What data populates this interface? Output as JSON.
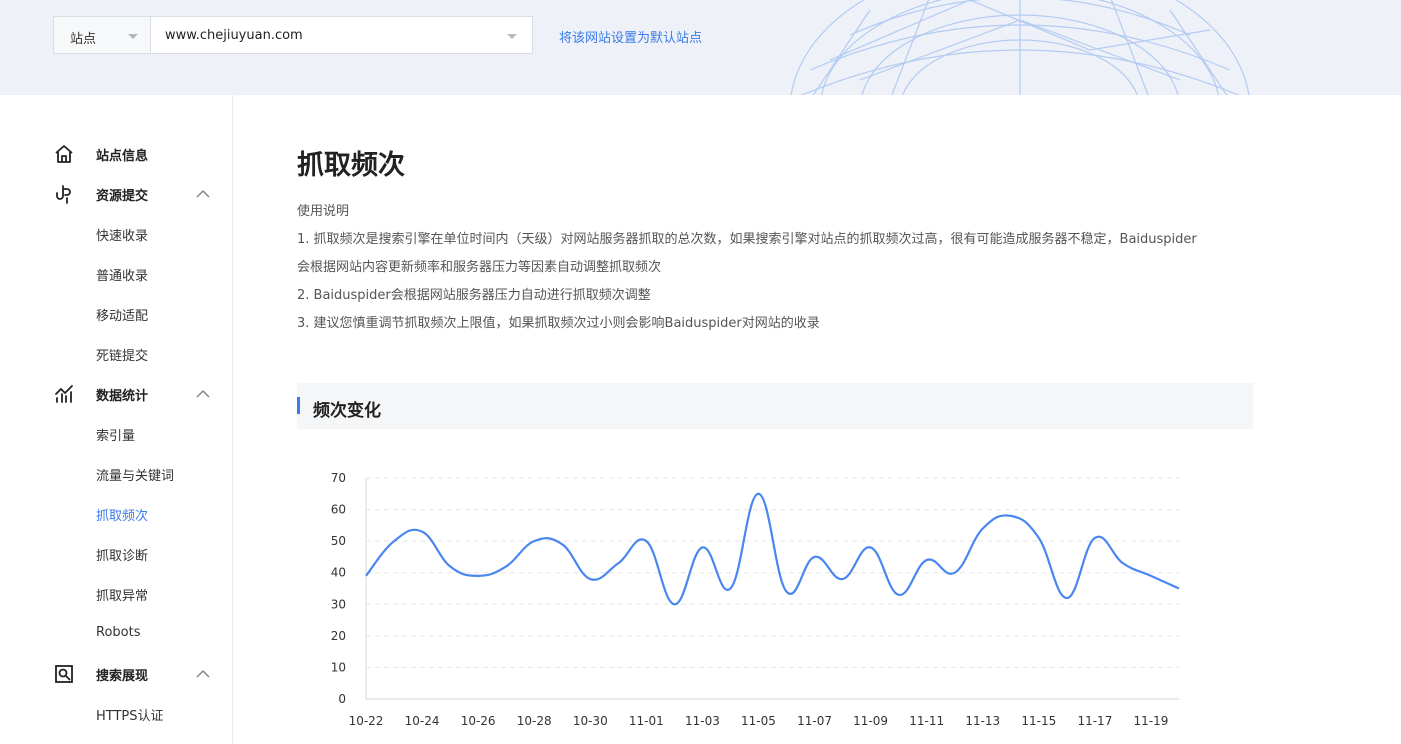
{
  "header": {
    "site_label": "站点",
    "site_url": "www.chejiuyuan.com",
    "set_default_link": "将该网站设置为默认站点"
  },
  "sidebar": {
    "groups": [
      {
        "title": "站点信息",
        "icon": "home-icon",
        "items": []
      },
      {
        "title": "资源提交",
        "icon": "submit-icon",
        "items": [
          "快速收录",
          "普通收录",
          "移动适配",
          "死链提交"
        ]
      },
      {
        "title": "数据统计",
        "icon": "stats-icon",
        "items": [
          "索引量",
          "流量与关键词",
          "抓取频次",
          "抓取诊断",
          "抓取异常",
          "Robots"
        ]
      },
      {
        "title": "搜索展现",
        "icon": "search-display-icon",
        "items": [
          "HTTPS认证"
        ]
      }
    ],
    "active_item": "抓取频次",
    "accent_color": "#3b7bea"
  },
  "main": {
    "title": "抓取频次",
    "usage_heading": "使用说明",
    "usage_lines": [
      "1. 抓取频次是搜索引擎在单位时间内（天级）对网站服务器抓取的总次数，如果搜索引擎对站点的抓取频次过高，很有可能造成服务器不稳定，Baiduspider",
      "会根据网站内容更新频率和服务器压力等因素自动调整抓取频次",
      "2. Baiduspider会根据网站服务器压力自动进行抓取频次调整",
      "3. 建议您慎重调节抓取频次上限值，如果抓取频次过小则会影响Baiduspider对网站的收录"
    ],
    "section_title": "频次变化"
  },
  "chart_data": {
    "type": "line",
    "x": [
      "10-22",
      "10-23",
      "10-24",
      "10-25",
      "10-26",
      "10-27",
      "10-28",
      "10-29",
      "10-30",
      "10-31",
      "11-01",
      "11-02",
      "11-03",
      "11-04",
      "11-05",
      "11-06",
      "11-07",
      "11-08",
      "11-09",
      "11-10",
      "11-11",
      "11-12",
      "11-13",
      "11-14",
      "11-15",
      "11-16",
      "11-17",
      "11-18",
      "11-19",
      "11-20"
    ],
    "x_tick_labels": [
      "10-22",
      "10-24",
      "10-26",
      "10-28",
      "10-30",
      "11-01",
      "11-03",
      "11-05",
      "11-07",
      "11-09",
      "11-11",
      "11-13",
      "11-15",
      "11-17",
      "11-19"
    ],
    "series": [
      {
        "values": [
          39,
          50,
          53,
          42,
          39,
          42,
          50,
          49,
          38,
          43,
          50,
          30,
          48,
          35,
          65,
          34,
          45,
          38,
          48,
          33,
          44,
          40,
          54,
          58,
          51,
          32,
          51,
          43,
          39,
          35
        ],
        "color": "#4a86f0"
      }
    ],
    "ylim": [
      0,
      70
    ],
    "yticks": [
      0,
      10,
      20,
      30,
      40,
      50,
      60,
      70
    ],
    "grid": true,
    "title": "",
    "xlabel": "",
    "ylabel": ""
  }
}
